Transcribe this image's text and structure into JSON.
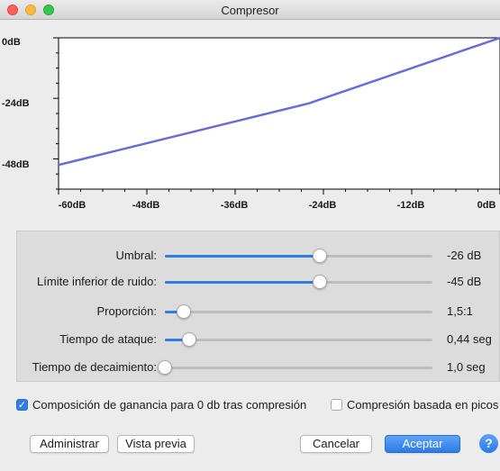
{
  "window": {
    "title": "Compresor"
  },
  "chart_data": {
    "type": "line",
    "x_ticks": [
      "-60dB",
      "-48dB",
      "-36dB",
      "-24dB",
      "-12dB",
      "0dB"
    ],
    "y_ticks": [
      "0dB",
      "-24dB",
      "-48dB"
    ],
    "xlim": [
      -60,
      0
    ],
    "ylim": [
      -60,
      0
    ],
    "series": [
      {
        "x": [
          -60,
          -26,
          0
        ],
        "y": [
          -50.4,
          -26,
          0
        ]
      }
    ],
    "line_color": "#6b6bd8"
  },
  "controls": [
    {
      "label": "Umbral:",
      "value": "-26 dB",
      "level": 0.58
    },
    {
      "label": "Límite inferior de ruido:",
      "value": "-45 dB",
      "level": 0.58
    },
    {
      "label": "Proporción:",
      "value": "1,5:1",
      "level": 0.07
    },
    {
      "label": "Tiempo de ataque:",
      "value": "0,44 seg",
      "level": 0.09
    },
    {
      "label": "Tiempo de decaimiento:",
      "value": "1,0 seg",
      "level": 0.0
    }
  ],
  "options": {
    "makeup_gain": {
      "label": "Composición de ganancia para 0 db tras compresión",
      "checked": true
    },
    "peak_based": {
      "label": "Compresión basada en picos",
      "checked": false
    }
  },
  "buttons": {
    "manage": "Administrar",
    "preview": "Vista previa",
    "cancel": "Cancelar",
    "ok": "Aceptar",
    "help": "?"
  },
  "colors": {
    "accent": "#2f7ee0",
    "curve": "#6b6bd8"
  }
}
